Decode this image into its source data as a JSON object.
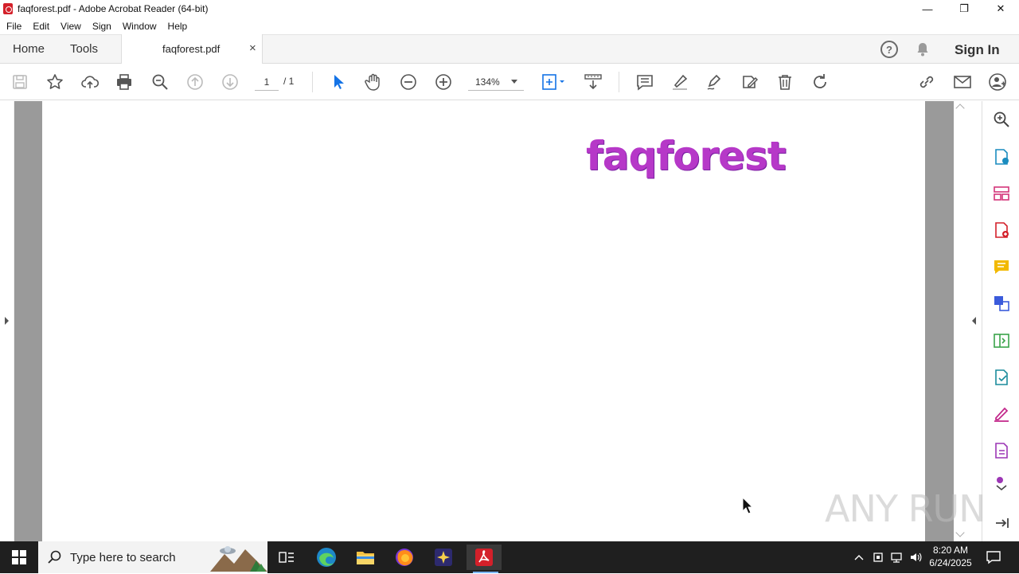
{
  "window": {
    "title": "faqforest.pdf - Adobe Acrobat Reader (64-bit)"
  },
  "menu": [
    "File",
    "Edit",
    "View",
    "Sign",
    "Window",
    "Help"
  ],
  "tabs": {
    "home": "Home",
    "tools": "Tools",
    "document": "faqforest.pdf",
    "close": "×"
  },
  "header": {
    "sign_in": "Sign In",
    "help": "?"
  },
  "toolbar": {
    "page_current": "1",
    "page_total": "/ 1",
    "zoom": "134%"
  },
  "document": {
    "logo_text": "faqforest"
  },
  "watermark": "ANY RUN",
  "taskbar": {
    "search_placeholder": "Type here to search",
    "time": "8:20 AM",
    "date": "6/24/2025"
  },
  "colors": {
    "accent": "#1473e6",
    "logo": "#b638c8",
    "taskbar": "#1f1f1f"
  }
}
